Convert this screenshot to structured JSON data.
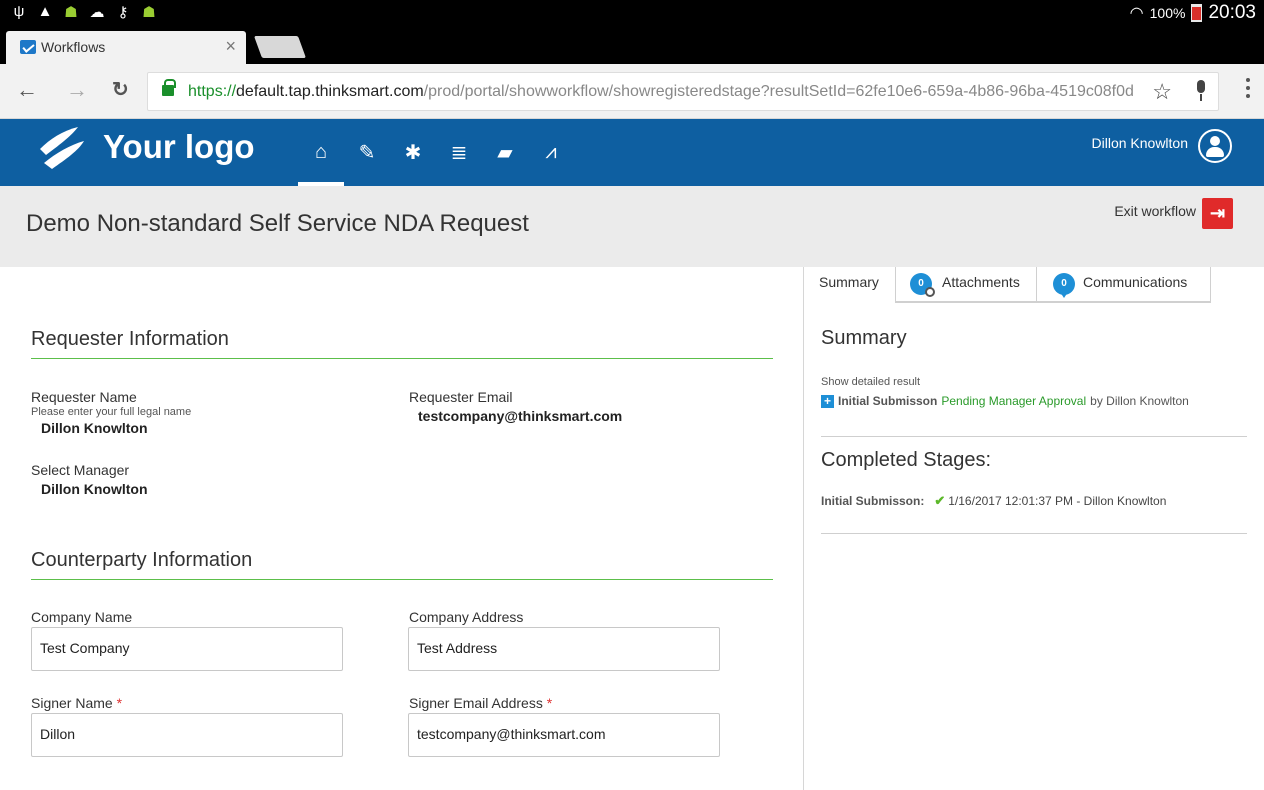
{
  "statusbar": {
    "battery_pct": "100%",
    "time": "20:03",
    "icons": [
      "usb-icon",
      "warning-icon",
      "android-icon",
      "cloud-sync-icon",
      "key-icon",
      "android-debug-icon",
      "wifi-icon",
      "battery-icon"
    ]
  },
  "browser": {
    "tab_title": "Workflows",
    "tab_close": "×",
    "url_scheme": "https://",
    "url_host": "default.tap.thinksmart.com",
    "url_path": "/prod/portal/showworkflow/showregisteredstage?resultSetId=62fe10e6-659a-4b86-96ba-4519c08f0d",
    "back": "←",
    "forward": "→",
    "reload": "C",
    "star": "☆"
  },
  "app": {
    "logo_text": "Your logo",
    "user_name": "Dillon Knowlton",
    "nav_icons": [
      "home-icon",
      "edit-form-icon",
      "settings-icon",
      "workflow-icon",
      "folder-icon",
      "chart-icon"
    ],
    "brand_color": "#0e5fa1"
  },
  "page": {
    "title": "Demo Non-standard Self Service NDA Request",
    "exit_label": "Exit workflow"
  },
  "form": {
    "requester_section": "Requester Information",
    "requester_name_label": "Requester Name",
    "requester_name_hint": "Please enter your full legal name",
    "requester_name_value": "Dillon Knowlton",
    "requester_email_label": "Requester Email",
    "requester_email_value": "testcompany@thinksmart.com",
    "manager_label": "Select Manager",
    "manager_value": "Dillon Knowlton",
    "counterparty_section": "Counterparty Information",
    "company_name_label": "Company Name",
    "company_name_value": "Test Company",
    "company_address_label": "Company Address",
    "company_address_value": "Test Address",
    "signer_name_label": "Signer Name",
    "signer_name_value": "Dillon",
    "signer_email_label": "Signer Email Address",
    "signer_email_value": "testcompany@thinksmart.com",
    "required_mark": "*"
  },
  "panel": {
    "tabs": {
      "summary": "Summary",
      "attachments": "Attachments",
      "attachments_count": "0",
      "communications": "Communications",
      "communications_count": "0"
    },
    "summary_heading": "Summary",
    "show_detailed": "Show detailed result",
    "status_stage": "Initial Submisson",
    "status_pending": "Pending Manager Approval",
    "status_by": "by Dillon Knowlton",
    "completed_heading": "Completed Stages:",
    "completed_stage": "Initial Submisson:",
    "completed_detail": "1/16/2017 12:01:37 PM - Dillon Knowlton"
  }
}
